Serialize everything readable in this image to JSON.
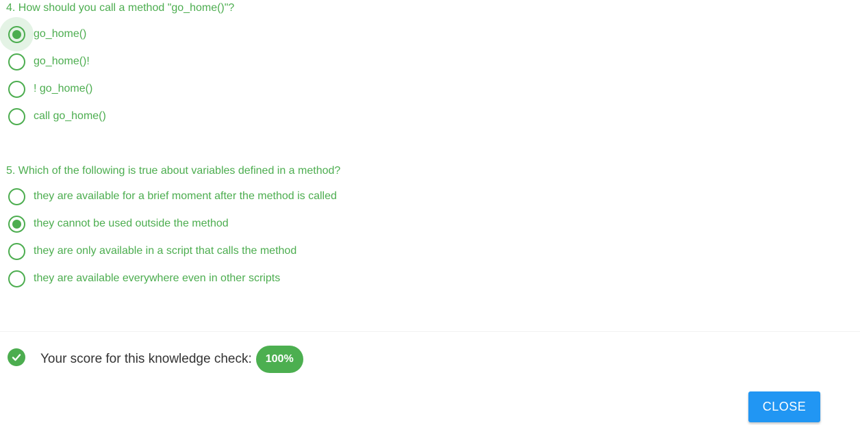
{
  "colors": {
    "accent": "#4cad4f",
    "badge": "#4caf50",
    "button": "#2196f3",
    "text_dark": "#333333"
  },
  "questions": [
    {
      "title": "4. How should you call a method \"go_home()\"?",
      "options": [
        {
          "label": "go_home()",
          "selected": true,
          "focused": true
        },
        {
          "label": "go_home()!",
          "selected": false
        },
        {
          "label": "! go_home()",
          "selected": false
        },
        {
          "label": "call go_home()",
          "selected": false
        }
      ]
    },
    {
      "title": "5. Which of the following is true about variables defined in a method?",
      "options": [
        {
          "label": "they are available for a brief moment after the method is called",
          "selected": false
        },
        {
          "label": "they cannot be used outside the method",
          "selected": true
        },
        {
          "label": "they are only available in a script that calls the method",
          "selected": false
        },
        {
          "label": "they are available everywhere even in other scripts",
          "selected": false
        }
      ]
    }
  ],
  "score": {
    "icon": "check-circle-icon",
    "label": "Your score for this knowledge check:",
    "value": "100%"
  },
  "close_label": "CLOSE"
}
